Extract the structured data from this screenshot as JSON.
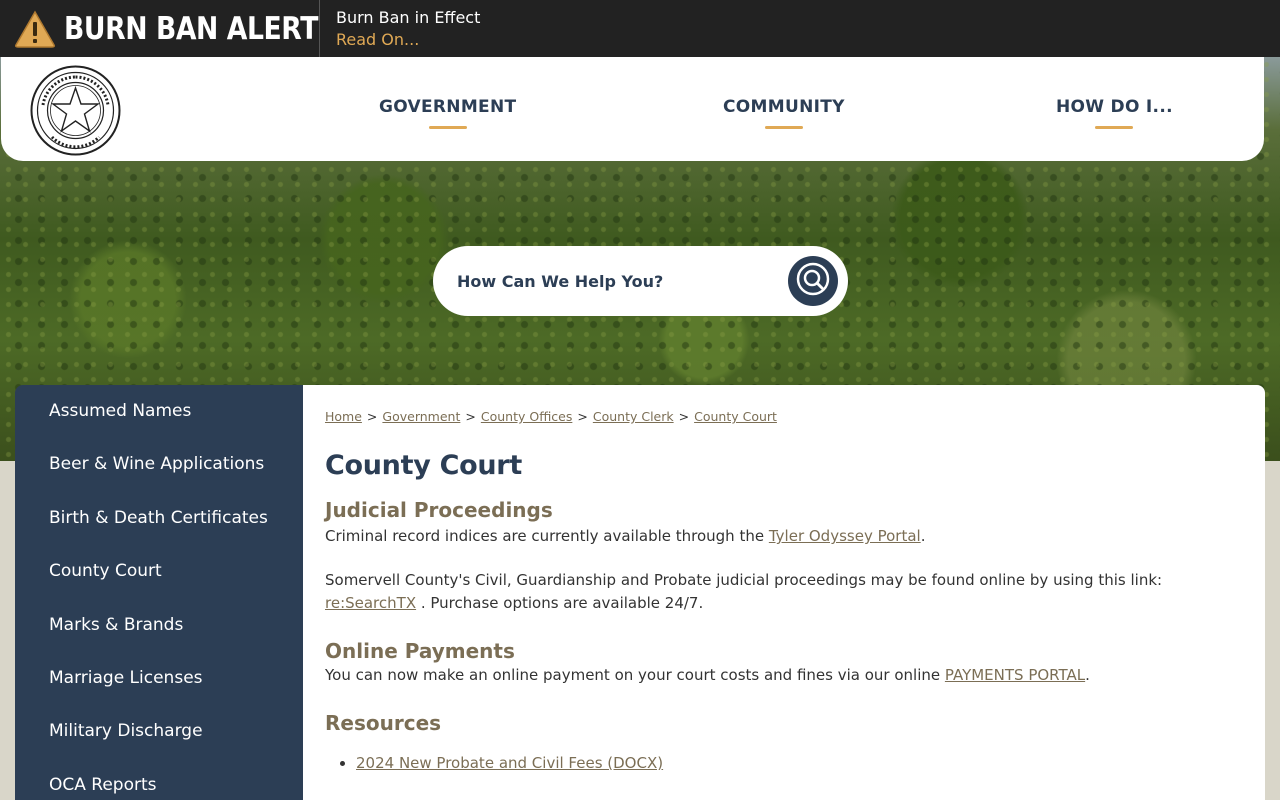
{
  "alert": {
    "title": "BURN BAN ALERT",
    "message": "Burn Ban in Effect",
    "link": "Read On..."
  },
  "header": {
    "logo_text": "SOMERVELL COUNTY TEXAS ORGANIZED 1875",
    "nav": [
      {
        "label": "GOVERNMENT"
      },
      {
        "label": "COMMUNITY"
      },
      {
        "label": "HOW DO I..."
      }
    ]
  },
  "search": {
    "placeholder": "How Can We Help You?"
  },
  "sidebar": {
    "items": [
      {
        "label": "Assumed Names"
      },
      {
        "label": "Beer & Wine Applications"
      },
      {
        "label": "Birth & Death Certificates"
      },
      {
        "label": "County Court"
      },
      {
        "label": "Marks & Brands"
      },
      {
        "label": "Marriage Licenses"
      },
      {
        "label": "Military Discharge"
      },
      {
        "label": "OCA Reports"
      }
    ]
  },
  "breadcrumb": [
    "Home",
    "Government",
    "County Offices",
    "County Clerk",
    "County Court"
  ],
  "breadcrumb_sep": ">",
  "page": {
    "title": "County Court",
    "sections": {
      "judicial": {
        "heading": "Judicial Proceedings",
        "p1_text": "Criminal record indices are currently available through the ",
        "p1_link": "Tyler Odyssey Portal",
        "p1_end": ".",
        "p2_text": "Somervell County's Civil, Guardianship and Probate judicial proceedings may be found online by using this link: ",
        "p2_link": "re:SearchTX",
        "p2_end": " . Purchase options are available 24/7."
      },
      "payments": {
        "heading": "Online Payments",
        "text": "You can now make an online payment on your court costs and fines via our online ",
        "link": "PAYMENTS PORTAL",
        "end": "."
      },
      "resources": {
        "heading": "Resources",
        "items": [
          "2024 New Probate and Civil Fees (DOCX)"
        ]
      }
    }
  },
  "colors": {
    "navy": "#2c3e55",
    "gold": "#e0a955",
    "tan_link": "#7b6e55",
    "alert_bg": "#222222"
  }
}
